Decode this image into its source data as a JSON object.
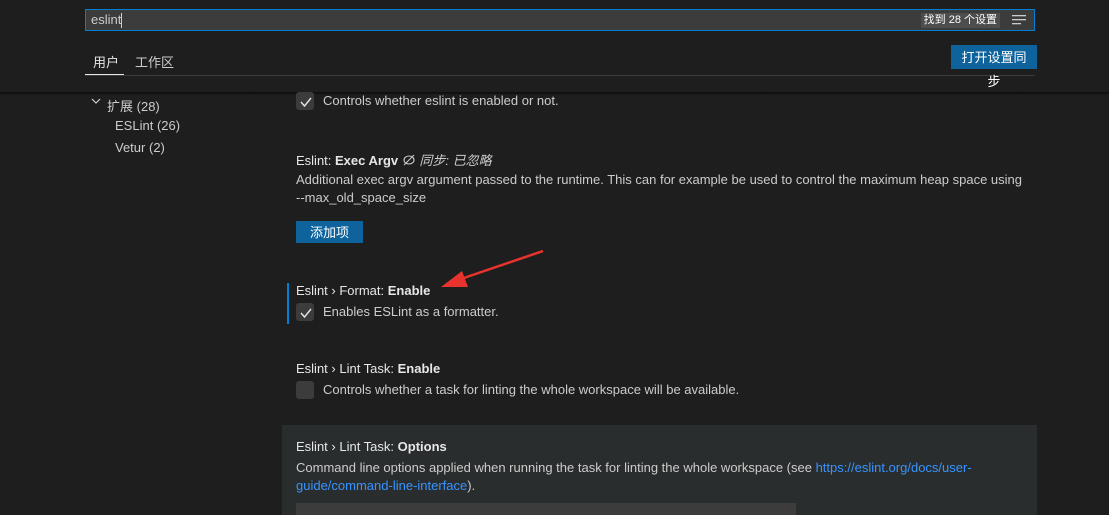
{
  "search": {
    "value": "eslint",
    "result_count": "找到 28 个设置"
  },
  "tabs": {
    "user": "用户",
    "workspace": "工作区"
  },
  "sync_button": "打开设置同步",
  "toc": {
    "extensions": {
      "label": "扩展",
      "count": "(28)"
    },
    "items": [
      {
        "label": "ESLint",
        "count": "(26)"
      },
      {
        "label": "Vetur",
        "count": "(2)"
      }
    ]
  },
  "settings": {
    "enable_desc": "Controls whether eslint is enabled or not.",
    "exec_argv": {
      "category": "Eslint: ",
      "name": "Exec Argv",
      "sync_note": "同步: 已忽略",
      "desc_line1": "Additional exec argv argument passed to the runtime. This can for example be used to control the maximum heap space using",
      "desc_line2": "--max_old_space_size",
      "add_button": "添加项"
    },
    "format_enable": {
      "category": "Eslint › Format: ",
      "name": "Enable",
      "desc": "Enables ESLint as a formatter."
    },
    "lint_task_enable": {
      "category": "Eslint › Lint Task: ",
      "name": "Enable",
      "desc": "Controls whether a task for linting the whole workspace will be available."
    },
    "lint_task_options": {
      "category": "Eslint › Lint Task: ",
      "name": "Options",
      "desc_before": "Command line options applied when running the task for linting the whole workspace (see ",
      "link_part1": "https://eslint.org/docs/user-",
      "link_part2": "guide/command-line-interface",
      "desc_after": ")."
    }
  },
  "colors": {
    "accent": "#0e639c",
    "focus": "#007fd4",
    "link": "#3794ff",
    "arrow": "#e8322e"
  }
}
